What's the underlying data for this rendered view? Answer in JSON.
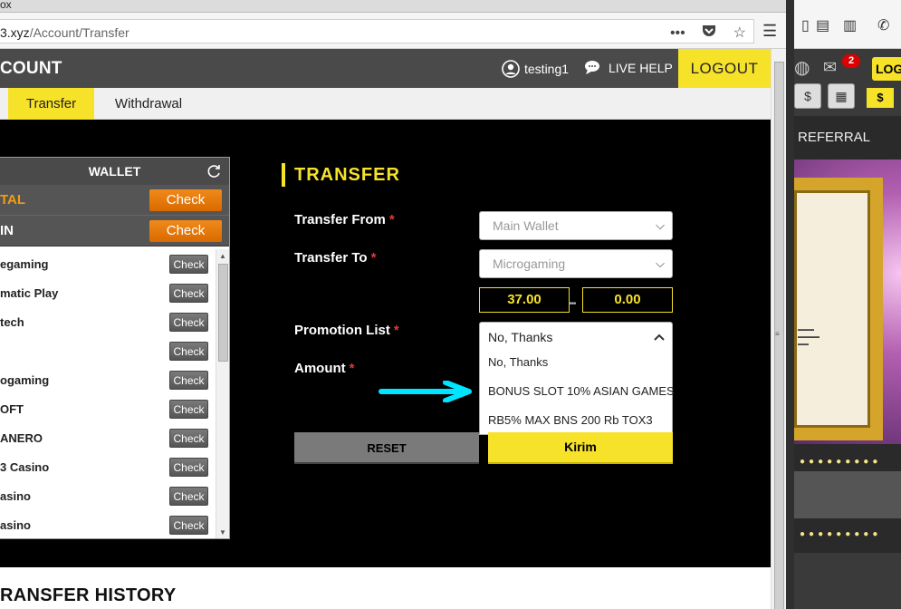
{
  "browser": {
    "window_title": "ox",
    "url_domain": "3.xyz",
    "url_path": "/Account/Transfer",
    "icons": [
      "more-icon",
      "pocket-icon",
      "bookmark-star-icon",
      "hamburger-menu-icon"
    ]
  },
  "header": {
    "title": "COUNT",
    "username": "testing1",
    "live_help": "LIVE HELP",
    "logout": "LOGOUT"
  },
  "tabs": [
    {
      "label": "Transfer",
      "active": true
    },
    {
      "label": "Withdrawal",
      "active": false
    }
  ],
  "wallet": {
    "title": "WALLET",
    "total_label": "TAL",
    "main_label": "IN",
    "check_label": "Check",
    "items": [
      {
        "name": "egaming"
      },
      {
        "name": "matic Play"
      },
      {
        "name": "tech"
      },
      {
        "name": ""
      },
      {
        "name": "ogaming"
      },
      {
        "name": "OFT"
      },
      {
        "name": "ANERO"
      },
      {
        "name": "3 Casino"
      },
      {
        "name": "asino"
      },
      {
        "name": "asino"
      }
    ]
  },
  "transfer": {
    "title": "TRANSFER",
    "from_label": "Transfer From",
    "from_value": "Main Wallet",
    "to_label": "Transfer To",
    "to_value": "Microgaming",
    "balance_from": "37.00",
    "balance_to": "0.00",
    "promo_label": "Promotion List",
    "promo_value": "No, Thanks",
    "promo_options": [
      "No, Thanks",
      "BONUS SLOT 10% ASIAN GAMES",
      "RB5% MAX BNS 200 Rb TOX3"
    ],
    "amount_label": "Amount",
    "required_mark": "*",
    "reset_button": "RESET",
    "submit_button": "Kirim"
  },
  "history_title": "RANSFER HISTORY",
  "right_window": {
    "referral": "REFERRAL",
    "mail_badge": "2",
    "login_partial": "LOG"
  },
  "colors": {
    "accent": "#f7e22a",
    "header_bg": "#4a4a4a",
    "check_orange": "#e67e22",
    "arrow": "#00e5ff"
  }
}
